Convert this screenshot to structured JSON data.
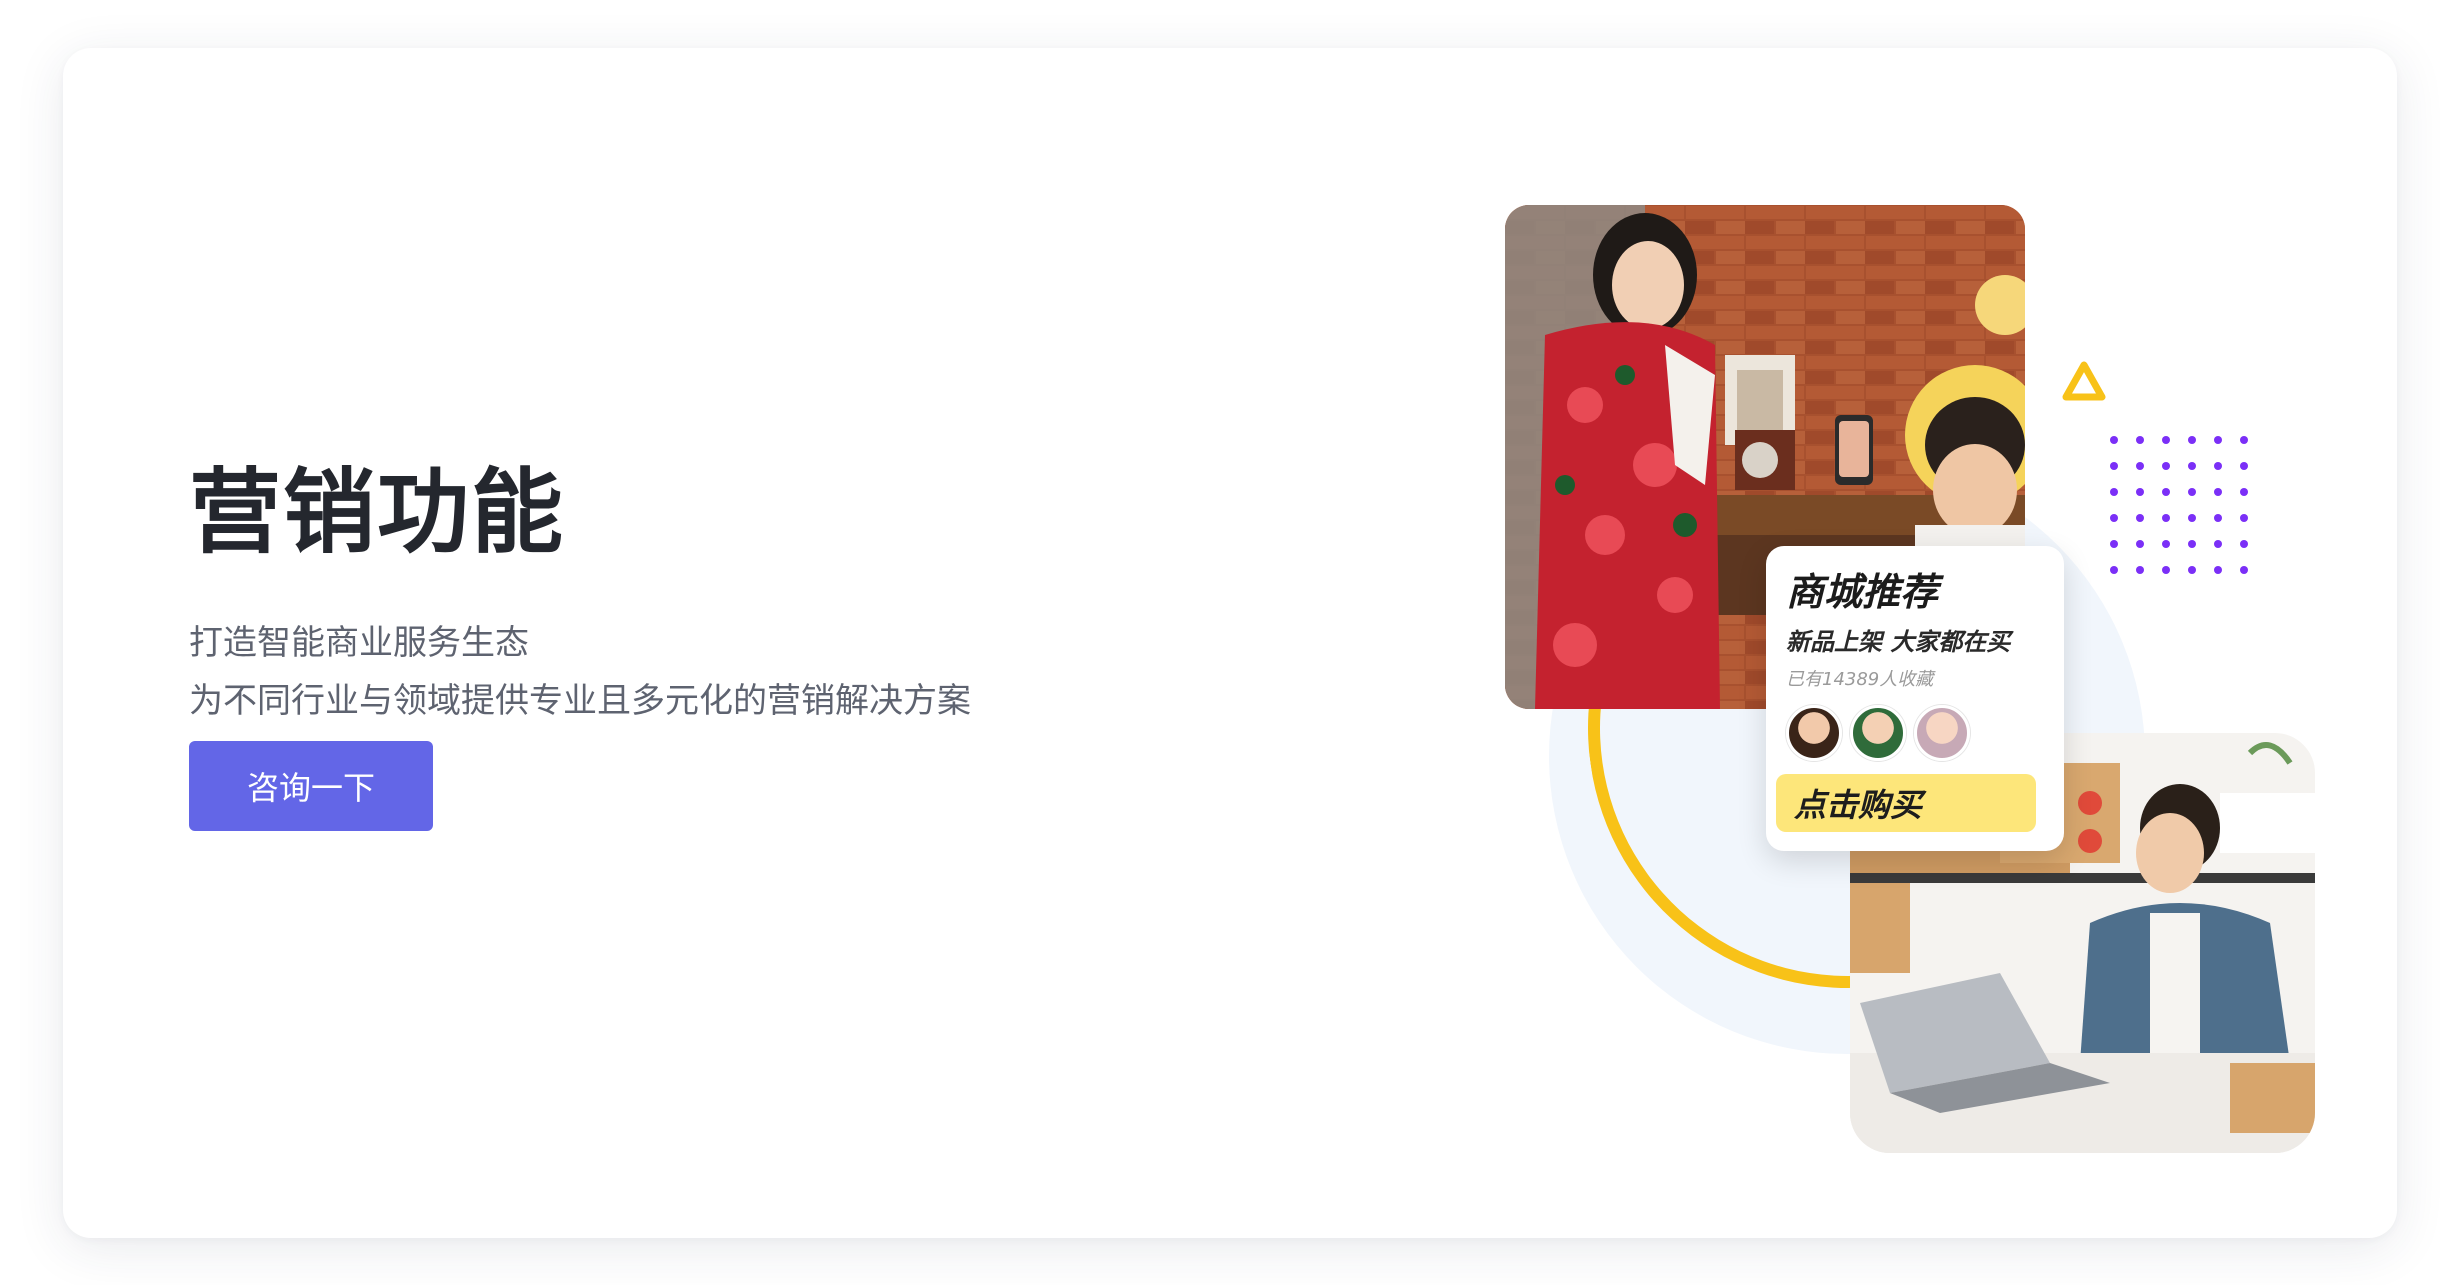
{
  "hero": {
    "title": "营销功能",
    "subtitle_line1": "打造智能商业服务生态",
    "subtitle_line2": "为不同行业与领域提供专业且多元化的营销解决方案",
    "cta_label": "咨询一下"
  },
  "promo_card": {
    "title": "商城推荐",
    "subtitle": "新品上架 大家都在买",
    "collected": "已有14389人收藏",
    "buy_label": "点击购买",
    "avatars": [
      "avatar-1",
      "avatar-2",
      "avatar-3"
    ]
  },
  "colors": {
    "accent": "#6366e7",
    "ring": "#f8c218",
    "buy_button": "#fde67a",
    "dots": "#7b2ff7",
    "title_text": "#24272e",
    "body_text": "#5e6370"
  },
  "icons": {
    "triangle": "triangle-icon",
    "dots": "dot-grid-decoration"
  }
}
